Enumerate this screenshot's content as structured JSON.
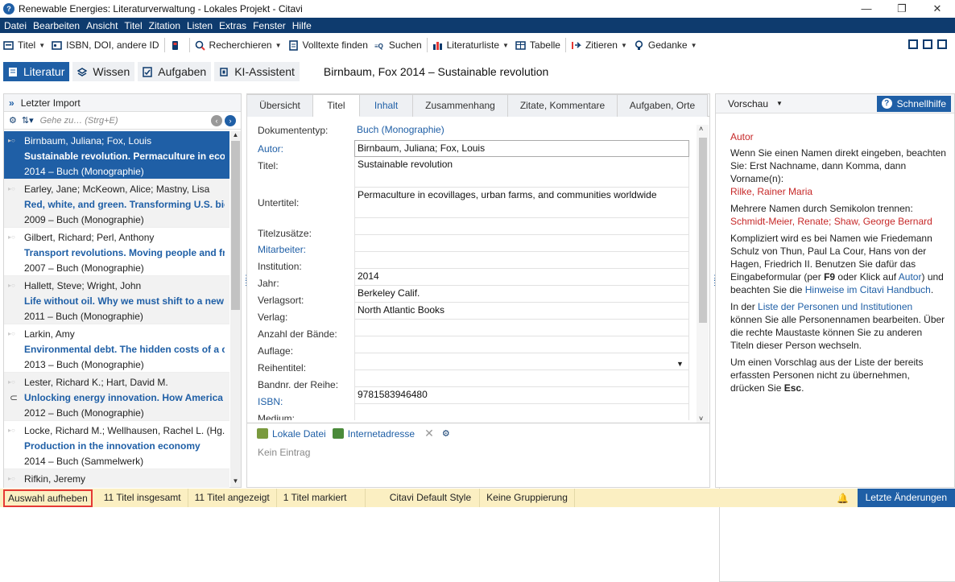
{
  "window": {
    "title": "Renewable Energies: Literaturverwaltung - Lokales Projekt - Citavi",
    "min": "—",
    "max": "❐",
    "close": "✕"
  },
  "menu": [
    "Datei",
    "Bearbeiten",
    "Ansicht",
    "Titel",
    "Zitation",
    "Listen",
    "Extras",
    "Fenster",
    "Hilfe"
  ],
  "toolbar": {
    "titel": "Titel",
    "isbn": "ISBN, DOI, andere ID",
    "recherchieren": "Recherchieren",
    "volltexte": "Volltexte finden",
    "suchen": "Suchen",
    "literaturliste": "Literaturliste",
    "tabelle": "Tabelle",
    "zitieren": "Zitieren",
    "gedanke": "Gedanke"
  },
  "nav": {
    "literatur": "Literatur",
    "wissen": "Wissen",
    "aufgaben": "Aufgaben",
    "ki": "KI-Assistent",
    "current_title": "Birnbaum, Fox 2014 – Sustainable revolution"
  },
  "left": {
    "header": "Letzter Import",
    "search_placeholder": "Gehe zu… (Strg+E)",
    "items": [
      {
        "author": "Birnbaum, Juliana; Fox, Louis",
        "title": "Sustainable revolution. Permaculture in ecovilla",
        "year": "2014 – Buch (Monographie)"
      },
      {
        "author": "Earley, Jane; McKeown, Alice; Mastny, Lisa",
        "title": "Red, white, and green. Transforming U.S. biofue",
        "year": "2009 – Buch (Monographie)"
      },
      {
        "author": "Gilbert, Richard; Perl, Anthony",
        "title": "Transport revolutions. Moving people and freig",
        "year": "2007 – Buch (Monographie)"
      },
      {
        "author": "Hallett, Steve; Wright, John",
        "title": "Life without oil. Why we must shift to a new ene",
        "year": "2011 – Buch (Monographie)"
      },
      {
        "author": "Larkin, Amy",
        "title": "Environmental debt. The hidden costs of a chan",
        "year": "2013 – Buch (Monographie)"
      },
      {
        "author": "Lester, Richard K.; Hart, David M.",
        "title": "Unlocking energy innovation. How America can",
        "year": "2012 – Buch (Monographie)"
      },
      {
        "author": "Locke, Richard M.; Wellhausen, Rachel L. (Hg.)",
        "title": "Production in the innovation economy",
        "year": "2014 – Buch (Sammelwerk)"
      },
      {
        "author": "Rifkin, Jeremy",
        "title": "",
        "year": ""
      }
    ]
  },
  "tabs": [
    "Übersicht",
    "Titel",
    "Inhalt",
    "Zusammenhang",
    "Zitate, Kommentare",
    "Aufgaben, Orte"
  ],
  "form": {
    "doctype_label": "Dokumententyp:",
    "doctype_value": "Buch (Monographie)",
    "fields": [
      {
        "label": "Autor:",
        "value": "Birnbaum, Juliana; Fox, Louis"
      },
      {
        "label": "Titel:",
        "value": "Sustainable revolution"
      },
      {
        "label": "Untertitel:",
        "value": "Permaculture in ecovillages, urban farms, and communities worldwide"
      },
      {
        "label": "Titelzusätze:",
        "value": ""
      },
      {
        "label": "Mitarbeiter:",
        "value": ""
      },
      {
        "label": "Institution:",
        "value": ""
      },
      {
        "label": "Jahr:",
        "value": "2014"
      },
      {
        "label": "Verlagsort:",
        "value": "Berkeley Calif."
      },
      {
        "label": "Verlag:",
        "value": "North Atlantic Books"
      },
      {
        "label": "Anzahl der Bände:",
        "value": ""
      },
      {
        "label": "Auflage:",
        "value": ""
      },
      {
        "label": "Reihentitel:",
        "value": ""
      },
      {
        "label": "Bandnr. der Reihe:",
        "value": ""
      },
      {
        "label": "ISBN:",
        "value": "9781583946480"
      },
      {
        "label": "Medium:",
        "value": ""
      }
    ],
    "lokale_datei": "Lokale Datei",
    "internetadresse": "Internetadresse",
    "kein_eintrag": "Kein Eintrag"
  },
  "preview": {
    "header": "Vorschau",
    "quickhelp": "Schnellhilfe",
    "heading": "Autor",
    "p1": "Wenn Sie einen Namen direkt eingeben, beachten Sie: Erst Nachname, dann Komma, dann Vorname(n):",
    "ex1": "Rilke, Rainer Maria",
    "p2": "Mehrere Namen durch Semikolon trennen:",
    "ex2": "Schmidt-Meier, Renate; Shaw, George Bernard",
    "p3a": "Kompliziert wird es bei Namen wie Friedemann Schulz von Thun, Paul La Cour, Hans von der Hagen, Friedrich II. Benutzen Sie dafür das Eingabeformular (per ",
    "p3key": "F9",
    "p3b": " oder Klick auf ",
    "p3link": "Autor",
    "p3c": ") und beachten Sie die ",
    "p3link2": "Hinweise im Citavi Handbuch",
    "p3d": ".",
    "p4a": "In der ",
    "p4link": "Liste der Personen und Institutionen",
    "p4b": " können Sie alle Personennamen bearbeiten. Über die rechte Maustaste können Sie zu anderen Titeln dieser Person wechseln.",
    "p5a": "Um einen Vorschlag aus der Liste der bereits erfassten Personen nicht zu übernehmen, drücken Sie ",
    "p5key": "Esc",
    "p5b": "."
  },
  "status": {
    "clear": "Auswahl aufheben",
    "total": "11 Titel insgesamt",
    "shown": "11 Titel angezeigt",
    "marked": "1 Titel markiert",
    "style": "Citavi Default Style",
    "grouping": "Keine Gruppierung",
    "changes": "Letzte Änderungen"
  }
}
